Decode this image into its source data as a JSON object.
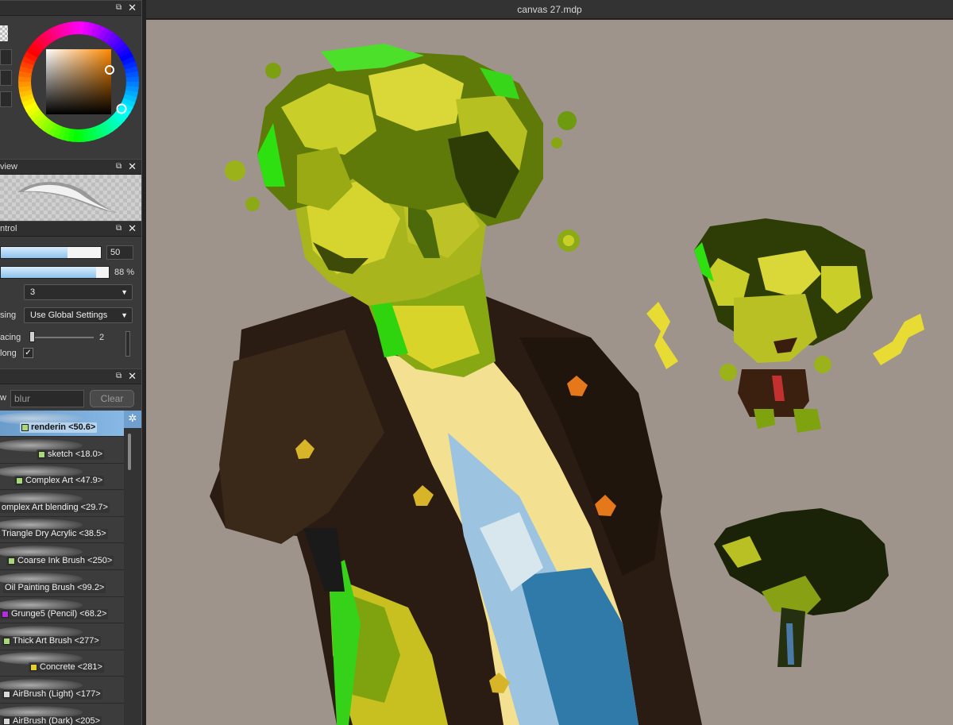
{
  "canvas": {
    "title": "canvas 27.mdp",
    "background": "#9e948c"
  },
  "panels": {
    "color": {
      "pin_icon": "pin-icon",
      "close_label": "✕"
    },
    "preview": {
      "title": "view",
      "close_label": "✕"
    },
    "control": {
      "title": "ntrol",
      "close_label": "✕"
    }
  },
  "brush_control": {
    "size_value": "50",
    "size_fraction": 0.67,
    "opacity_value": "88 %",
    "opacity_fraction": 0.88,
    "density_value": "3",
    "blend_label": "sing",
    "blend_value": "Use Global Settings",
    "spacing_label": "acing",
    "spacing_value": "2",
    "along_label": "long",
    "along_checked": "✓"
  },
  "brush_list": {
    "search_label": "w",
    "search_value": "blur",
    "clear_label": "Clear",
    "items": [
      {
        "name": "renderin <50.6>",
        "color": "#a8d878",
        "selected": true
      },
      {
        "name": "sketch <18.0>",
        "color": "#a8d878"
      },
      {
        "name": "Complex Art <47.9>",
        "color": "#a8d878"
      },
      {
        "name": "omplex Art blending <29.7>",
        "color": ""
      },
      {
        "name": "Triangle Dry Acrylic <38.5>",
        "color": ""
      },
      {
        "name": "Coarse Ink Brush <250>",
        "color": "#a8d878"
      },
      {
        "name": "Oil Painting Brush <99.2>",
        "color": ""
      },
      {
        "name": "Grunge5 (Pencil) <68.2>",
        "color": "#b22ee0"
      },
      {
        "name": "Thick Art Brush <277>",
        "color": "#a8d878"
      },
      {
        "name": "Concrete <281>",
        "color": "#e6d020"
      },
      {
        "name": "AirBrush (Light) <177>",
        "color": "#d8d8d8"
      },
      {
        "name": "AirBrush (Dark) <205>",
        "color": "#d8d8d8"
      }
    ]
  },
  "colors": {
    "accent": "#7ab0e0",
    "panel": "#3a3a3a"
  }
}
